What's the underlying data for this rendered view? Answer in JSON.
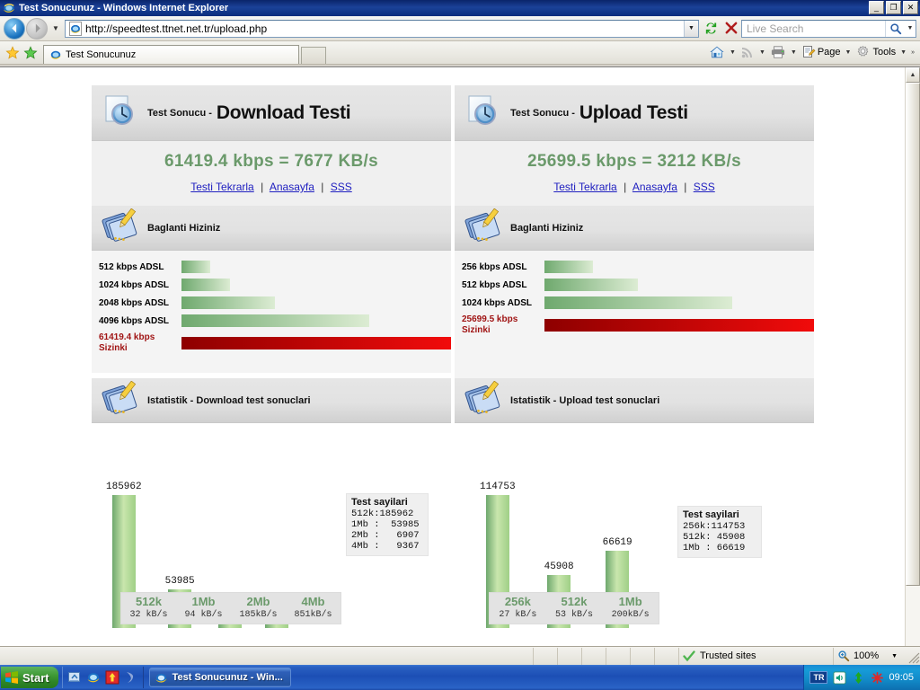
{
  "window": {
    "title": "Test Sonucunuz - Windows Internet Explorer",
    "minimize_label": "_",
    "maximize_label": "❐",
    "close_label": "✕"
  },
  "navbar": {
    "back_label": "←",
    "forward_label": "→",
    "history_caret": "▼",
    "url": "http://speedtest.ttnet.net.tr/upload.php",
    "url_dropdown_caret": "▼",
    "refresh_icon": "refresh-icon",
    "stop_icon": "stop-icon",
    "search_placeholder": "Live Search",
    "search_caret": "▼"
  },
  "tabbar": {
    "favorites_icon": "star-icon",
    "add_favorites_icon": "add-favorites-icon",
    "tab_title": "Test Sonucunuz",
    "new_tab_label": "",
    "commands": [
      {
        "name": "home",
        "label": "",
        "caret": "▼"
      },
      {
        "name": "feeds",
        "label": "",
        "caret": "▼"
      },
      {
        "name": "print",
        "label": "",
        "caret": "▼"
      },
      {
        "name": "page",
        "label": "Page",
        "caret": "▼"
      },
      {
        "name": "tools",
        "label": "Tools",
        "caret": "▼"
      }
    ],
    "overflow_label": "»"
  },
  "download": {
    "header_prefix": "Test Sonucu -",
    "header_title": "Download Testi",
    "result": "61419.4 kbps = 7677 KB/s",
    "links": [
      {
        "label": "Testi Tekrarla"
      },
      {
        "label": "Anasayfa"
      },
      {
        "label": "SSS"
      }
    ],
    "link_separator": "|",
    "compare_header": "Baglanti Hiziniz",
    "compare_rows": [
      {
        "label": "512 kbps ADSL",
        "width_pct": 10.6,
        "type": "green"
      },
      {
        "label": "1024 kbps ADSL",
        "width_pct": 18.0,
        "type": "green"
      },
      {
        "label": "2048 kbps ADSL",
        "width_pct": 34.8,
        "type": "green"
      },
      {
        "label": "4096 kbps ADSL",
        "width_pct": 69.8,
        "type": "green"
      }
    ],
    "mine_label_top": "61419.4 kbps",
    "mine_label_bottom": "Sizinki",
    "mine_width_pct": 100,
    "stats_header": "Istatistik - Download test sonuclari"
  },
  "upload": {
    "header_prefix": "Test Sonucu -",
    "header_title": "Upload Testi",
    "result": "25699.5 kbps = 3212 KB/s",
    "links": [
      {
        "label": "Testi Tekrarla"
      },
      {
        "label": "Anasayfa"
      },
      {
        "label": "SSS"
      }
    ],
    "link_separator": "|",
    "compare_header": "Baglanti Hiziniz",
    "compare_rows": [
      {
        "label": "256 kbps ADSL",
        "width_pct": 18.0,
        "type": "green"
      },
      {
        "label": "512 kbps ADSL",
        "width_pct": 34.8,
        "type": "green"
      },
      {
        "label": "1024 kbps ADSL",
        "width_pct": 69.8,
        "type": "green"
      }
    ],
    "mine_label_top": "25699.5 kbps",
    "mine_label_bottom": "Sizinki",
    "mine_width_pct": 100,
    "stats_header": "Istatistik - Upload test sonuclari"
  },
  "chart_data": [
    {
      "type": "bar",
      "title": "Istatistik - Download test sonuclari",
      "categories": [
        "512k",
        "1Mb",
        "2Mb",
        "4Mb"
      ],
      "category_sublabels": [
        "32 kB/s",
        "94 kB/s",
        "185kB/s",
        "851kB/s"
      ],
      "values": [
        185962,
        53985,
        6907,
        9367
      ],
      "value_labels": [
        "185962",
        "53985",
        "6907",
        "9367"
      ],
      "xlabel": "",
      "ylabel": "",
      "ylim": [
        0,
        185962
      ],
      "grid": false,
      "legend": {
        "title": "Test sayilari",
        "position": "right",
        "lines": [
          "512k:185962",
          "1Mb :  53985",
          "2Mb :   6907",
          "4Mb :   9367"
        ]
      }
    },
    {
      "type": "bar",
      "title": "Istatistik - Upload test sonuclari",
      "categories": [
        "256k",
        "512k",
        "1Mb"
      ],
      "category_sublabels": [
        "27 kB/s",
        "53 kB/s",
        "200kB/s"
      ],
      "values": [
        114753,
        45908,
        66619
      ],
      "value_labels": [
        "114753",
        "45908",
        "66619"
      ],
      "xlabel": "",
      "ylabel": "",
      "ylim": [
        0,
        114753
      ],
      "grid": false,
      "legend": {
        "title": "Test sayilari",
        "position": "right",
        "lines": [
          "256k:114753",
          "512k: 45908",
          "1Mb : 66619"
        ]
      }
    }
  ],
  "statusbar": {
    "message": "",
    "zone_icon": "trusted-check-icon",
    "zone_label": "Trusted sites",
    "zoom_icon": "zoom-magnifier-icon",
    "zoom_label": "100%",
    "zoom_caret": "▼"
  },
  "taskbar": {
    "start_label": "Start",
    "quicklaunch": [
      {
        "name": "show-desktop-icon"
      },
      {
        "name": "internet-explorer-icon"
      },
      {
        "name": "flashget-icon"
      },
      {
        "name": "media-player-icon"
      }
    ],
    "tasks": [
      {
        "label": "Test Sonucunuz - Win...",
        "icon": "internet-explorer-icon"
      }
    ],
    "tray": {
      "language": "TR",
      "icons": [
        "volume-icon",
        "network-icon",
        "antivirus-icon"
      ],
      "clock": "09:05"
    }
  },
  "colors": {
    "accent_green": "#6b9a6b",
    "bar_green_dark": "#6fa96e",
    "bar_green_light": "#dcecd3",
    "bar_red_dark": "#8e0000",
    "bar_red_light": "#f10b0b",
    "link_blue": "#2020c0",
    "titlebar_blue": "#1b4298"
  }
}
